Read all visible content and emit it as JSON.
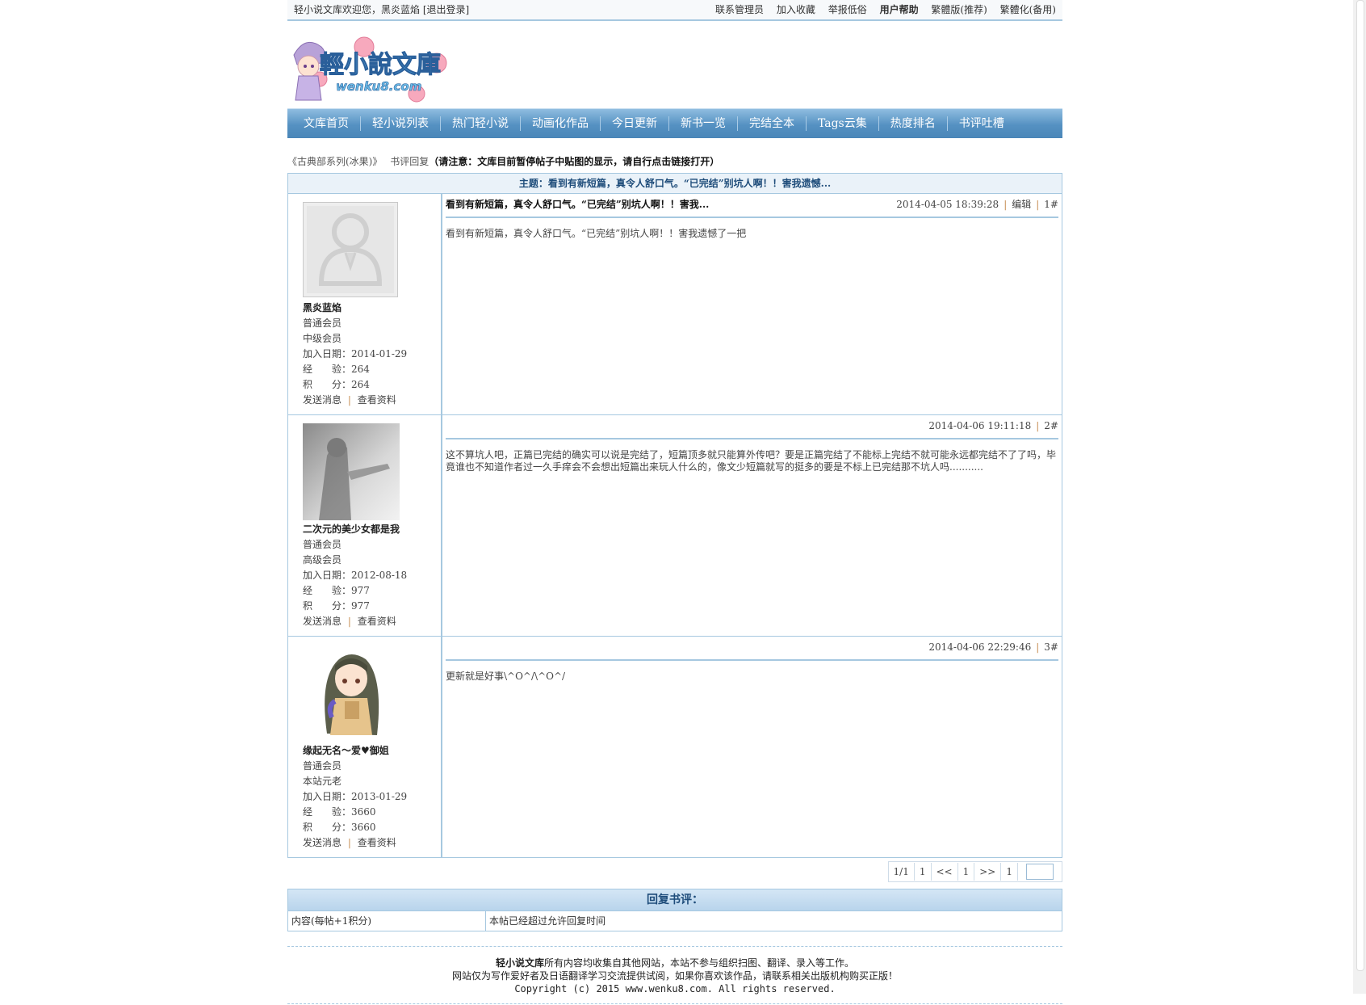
{
  "topbar": {
    "welcome": "轻小说文库欢迎您，黑炎蓝焰 [退出登录]",
    "links": [
      "联系管理员",
      "加入收藏",
      "举报低俗",
      "用户帮助",
      "繁體版(推荐)",
      "繁體化(备用)"
    ]
  },
  "logo": {
    "title": "輕小說文庫",
    "sub": "wenku8.com"
  },
  "nav": [
    "文库首页",
    "轻小说列表",
    "热门轻小说",
    "动画化作品",
    "今日更新",
    "新书一览",
    "完结全本",
    "Tags云集",
    "热度排名",
    "书评吐槽"
  ],
  "breadcrumb": {
    "book": "《古典部系列(冰果)》",
    "section": "书评回复",
    "notice": "（请注意：文库目前暂停帖子中贴图的显示，请自行点击链接打开）"
  },
  "subject": "主题：看到有新短篇，真令人舒口气。“已完结”别坑人啊！！害我遗憾...",
  "posts": [
    {
      "user": "黑炎蓝焰",
      "rank": "普通会员",
      "level": "中级会员",
      "join": "加入日期：2014-01-29",
      "exp": "经　　验：264",
      "score": "积　　分：264",
      "send": "发送消息",
      "profile": "查看资料",
      "title": "看到有新短篇，真令人舒口气。“已完结”别坑人啊！！害我...",
      "time": "2014-04-05 18:39:28",
      "edit": "编辑",
      "floor": "1#",
      "body": "看到有新短篇，真令人舒口气。“已完结”别坑人啊！！害我遗憾了一把"
    },
    {
      "user": "二次元的美少女都是我",
      "rank": "普通会员",
      "level": "高级会员",
      "join": "加入日期：2012-08-18",
      "exp": "经　　验：977",
      "score": "积　　分：977",
      "send": "发送消息",
      "profile": "查看资料",
      "title": "",
      "time": "2014-04-06 19:11:18",
      "edit": "",
      "floor": "2#",
      "body": "这不算坑人吧，正篇已完结的确实可以说是完结了，短篇顶多就只能算外传吧？要是正篇完结了不能标上完结不就可能永远都完结不了了吗，毕竟谁也不知道作者过一久手痒会不会想出短篇出来玩人什么的，像文少短篇就写的挺多的要是不标上已完结那不坑人吗..........."
    },
    {
      "user": "缘起无名～爱♥御姐",
      "rank": "普通会员",
      "level": "本站元老",
      "join": "加入日期：2013-01-29",
      "exp": "经　　验：3660",
      "score": "积　　分：3660",
      "send": "发送消息",
      "profile": "查看资料",
      "title": "",
      "time": "2014-04-06 22:29:46",
      "edit": "",
      "floor": "3#",
      "body": "更新就是好事\\^O^/\\^O^/"
    }
  ],
  "pager": {
    "info": "1/1",
    "first": "1",
    "prev": "<<",
    "current": "1",
    "next": ">>",
    "last": "1"
  },
  "reply": {
    "title": "回复书评：",
    "content_label": "内容(每帖+1积分)",
    "content_note": "本帖已经超过允许回复时间"
  },
  "footer": {
    "brand": "轻小说文库",
    "line1_rest": "所有内容均收集自其他网站，本站不参与组织扫图、翻译、录入等工作。",
    "line2": "网站仅为写作爱好者及日语翻译学习交流提供试阅，如果你喜欢该作品，请联系相关出版机构购买正版！",
    "line3": "Copyright (c) 2015 www.wenku8.com. All rights reserved."
  }
}
